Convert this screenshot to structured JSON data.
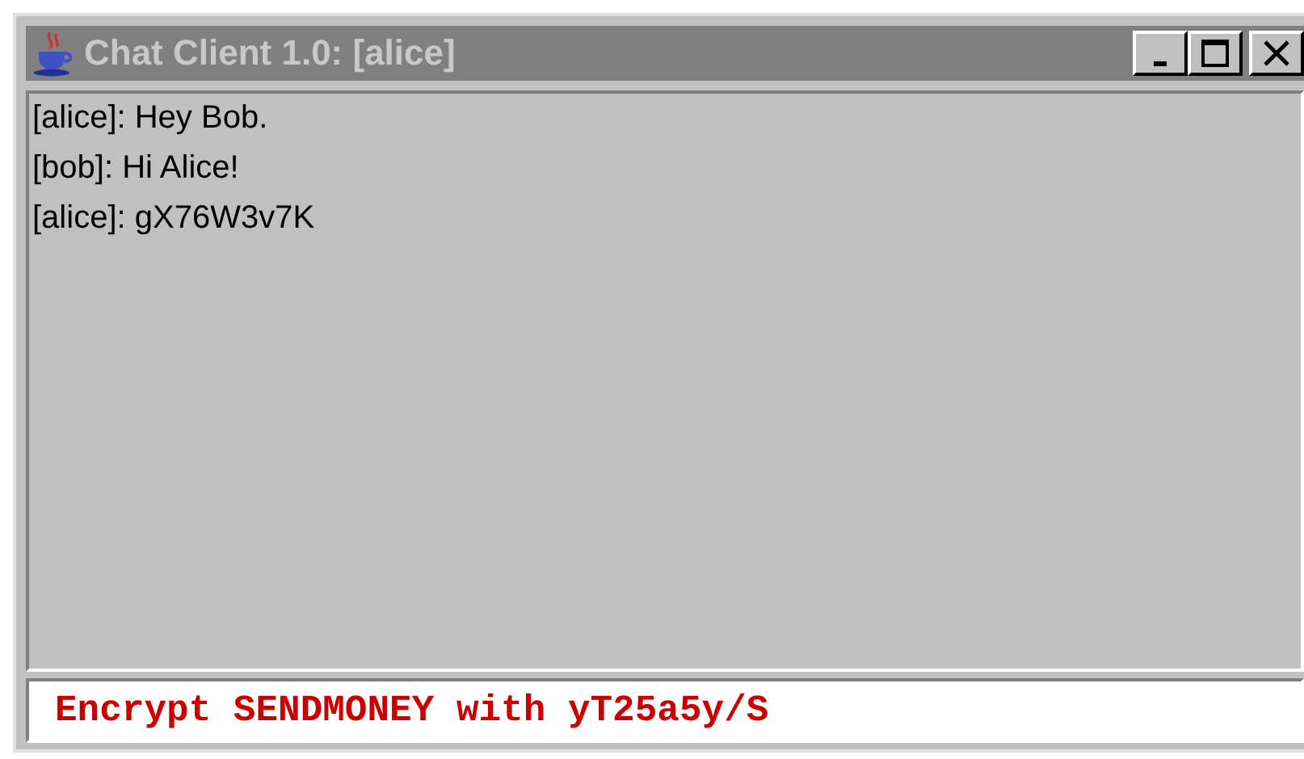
{
  "window": {
    "title": "Chat Client 1.0: [alice]",
    "active": false
  },
  "messages": [
    "[alice]: Hey Bob.",
    "[bob]: Hi Alice!",
    "[alice]: gX76W3v7K"
  ],
  "input": {
    "value": "Encrypt SENDMONEY with yT25a5y/S"
  }
}
